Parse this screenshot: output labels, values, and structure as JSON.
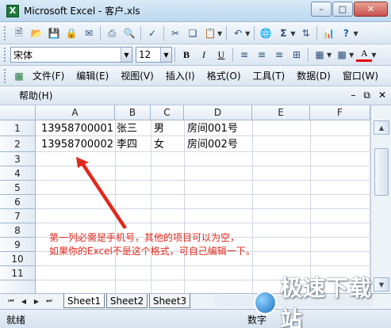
{
  "window": {
    "title": "Microsoft Excel - 客户.xls",
    "app_icon": "X",
    "controls": [
      "–",
      "□",
      "✕"
    ]
  },
  "toolbar_standard": {
    "icons": [
      "new-icon",
      "open-icon",
      "save-icon",
      "permission-icon",
      "email-icon",
      "print-icon",
      "print-preview-icon",
      "spelling-icon",
      "cut-icon",
      "copy-icon",
      "paste-icon",
      "undo-icon",
      "hyperlink-icon",
      "autosum-icon",
      "sort-icon",
      "chart-icon",
      "help-icon"
    ]
  },
  "toolbar_format": {
    "font_name": "宋体",
    "font_size": "12",
    "bold": "B",
    "italic": "I",
    "underline": "U",
    "font_color_label": "A"
  },
  "menu": {
    "items": [
      "文件(F)",
      "编辑(E)",
      "视图(V)",
      "插入(I)",
      "格式(O)",
      "工具(T)",
      "数据(D)",
      "窗口(W)"
    ],
    "help": "帮助(H)",
    "mdi_controls": [
      "–",
      "ᵑ",
      "✕"
    ]
  },
  "sheet": {
    "columns": [
      "A",
      "B",
      "C",
      "D",
      "E",
      "F"
    ],
    "rows": [
      "1",
      "2",
      "3",
      "4",
      "5",
      "6",
      "7",
      "8",
      "9",
      "10",
      "11"
    ],
    "cells": [
      {
        "ref": "A1",
        "value": "13958700001"
      },
      {
        "ref": "B1",
        "value": "张三"
      },
      {
        "ref": "C1",
        "value": "男"
      },
      {
        "ref": "D1",
        "value": "房间001号"
      },
      {
        "ref": "A2",
        "value": "13958700002"
      },
      {
        "ref": "B2",
        "value": "李四"
      },
      {
        "ref": "C2",
        "value": "女"
      },
      {
        "ref": "D2",
        "value": "房间002号"
      }
    ],
    "annotation_line1": "第一列必需是手机号，其他的项目可以为空，",
    "annotation_line2": "如果你的Excel不是这个格式，可自己编辑一下。",
    "annotation_color": "#e2281b"
  },
  "tabs": {
    "nav": [
      "⏮",
      "◀",
      "▶",
      "⏭"
    ],
    "sheets": [
      "Sheet1",
      "Sheet2",
      "Sheet3"
    ]
  },
  "status": {
    "left": "就绪",
    "right": "数字"
  },
  "watermark": {
    "text": "极速下载站"
  }
}
